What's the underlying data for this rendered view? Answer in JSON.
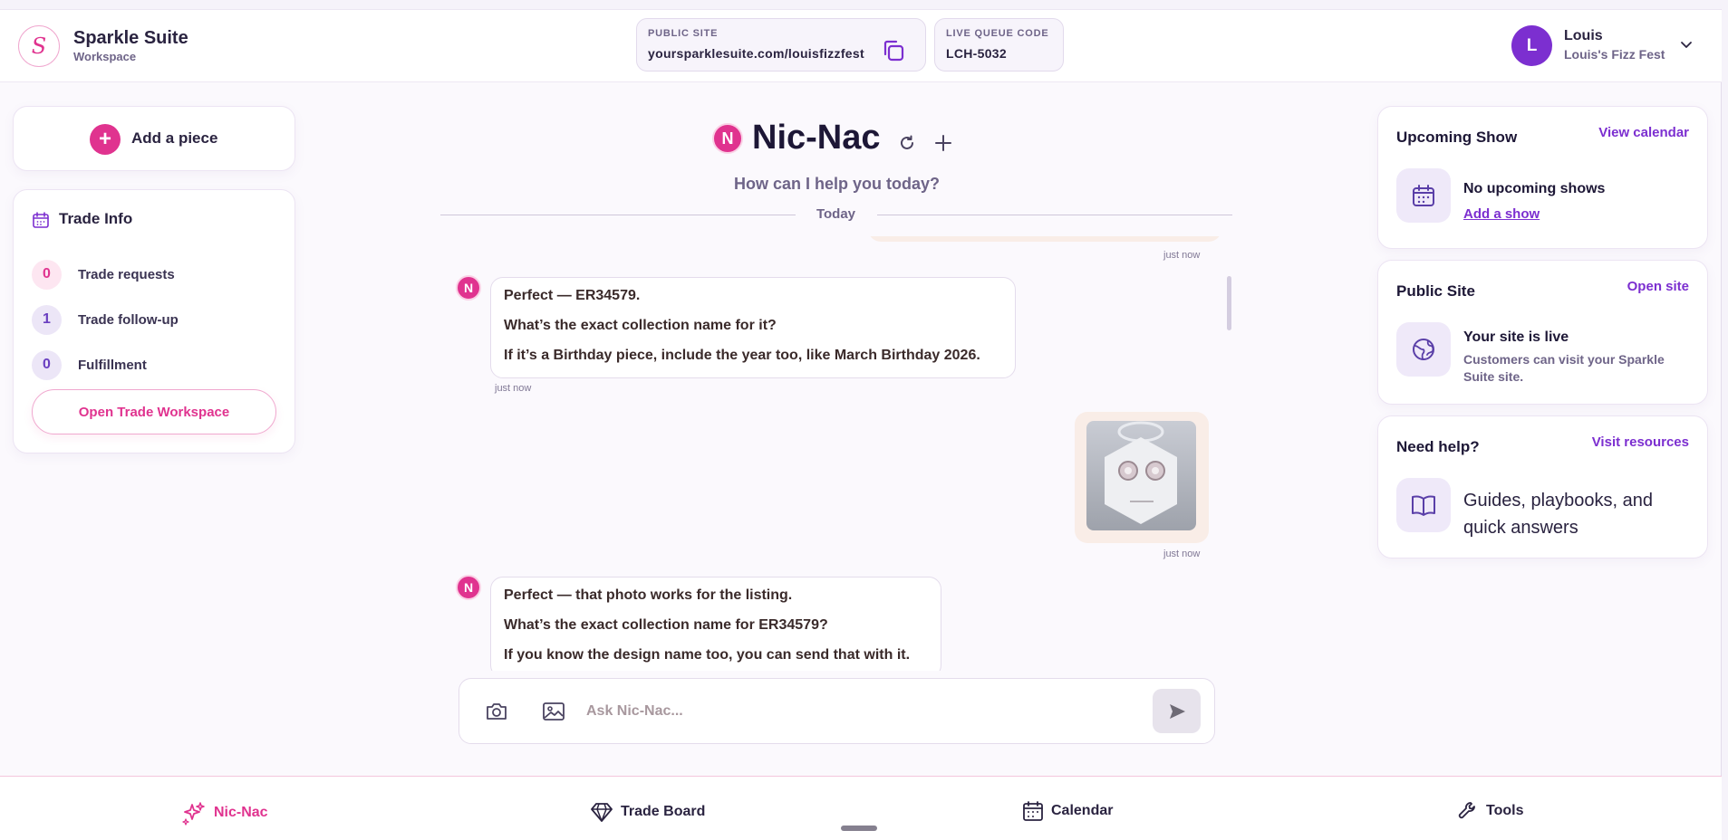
{
  "brand": {
    "logo_letter": "S",
    "name": "Sparkle Suite",
    "subtitle": "Workspace"
  },
  "header": {
    "public_site": {
      "label": "PUBLIC SITE",
      "value": "yoursparklesuite.com/louisfizzfest",
      "icon": "copy-icon"
    },
    "live_queue": {
      "label": "LIVE QUEUE CODE",
      "value": "LCH-5032"
    },
    "user": {
      "initial": "L",
      "name": "Louis",
      "subtitle": "Louis's Fizz Fest"
    }
  },
  "left": {
    "add_piece": {
      "icon": "+",
      "label": "Add a piece"
    },
    "trade_info": {
      "title": "Trade Info",
      "rows": [
        {
          "count": "0",
          "label": "Trade requests",
          "badge_bg": "#fde6f1",
          "badge_color": "#e0338f"
        },
        {
          "count": "1",
          "label": "Trade follow-up",
          "badge_bg": "#ece6f7",
          "badge_color": "#6a3fc0"
        },
        {
          "count": "0",
          "label": "Fulfillment",
          "badge_bg": "#ece6f7",
          "badge_color": "#6a3fc0"
        }
      ],
      "button": "Open Trade Workspace"
    }
  },
  "chat": {
    "assistant_initial": "N",
    "title": "Nic-Nac",
    "subtitle": "How can I help you today?",
    "day_label": "Today",
    "messages": [
      {
        "from": "user",
        "time": "just now"
      },
      {
        "from": "assistant",
        "lines": [
          "Perfect — ER34579.",
          "What’s the exact collection name for it?",
          "If it’s a Birthday piece, include the year too, like March Birthday 2026."
        ],
        "time": "just now"
      },
      {
        "from": "user",
        "image": "earring-photo",
        "time": "just now"
      },
      {
        "from": "assistant",
        "lines": [
          "Perfect — that photo works for the listing.",
          "What’s the exact collection name for ER34579?",
          "If you know the design name too, you can send that with it."
        ]
      }
    ],
    "composer_placeholder": "Ask Nic-Nac..."
  },
  "right": {
    "upcoming_show": {
      "title": "Upcoming Show",
      "link": "View calendar",
      "main": "No upcoming shows",
      "action": "Add a show"
    },
    "public_site": {
      "title": "Public Site",
      "link": "Open site",
      "main": "Your site is live",
      "sub": "Customers can visit your Sparkle Suite site."
    },
    "help": {
      "title": "Need help?",
      "link": "Visit resources",
      "main": "Guides, playbooks, and quick answers"
    }
  },
  "bottom_nav": [
    {
      "label": "Nic-Nac",
      "icon": "sparkles-icon",
      "active": true
    },
    {
      "label": "Trade Board",
      "icon": "diamond-icon",
      "active": false
    },
    {
      "label": "Calendar",
      "icon": "calendar-icon",
      "active": false
    },
    {
      "label": "Tools",
      "icon": "wrench-icon",
      "active": false
    }
  ],
  "colors": {
    "brand_pink": "#e0338f",
    "accent_purple": "#7c2fd0",
    "text_dark": "#1d1736",
    "text_muted": "#6e6488"
  }
}
